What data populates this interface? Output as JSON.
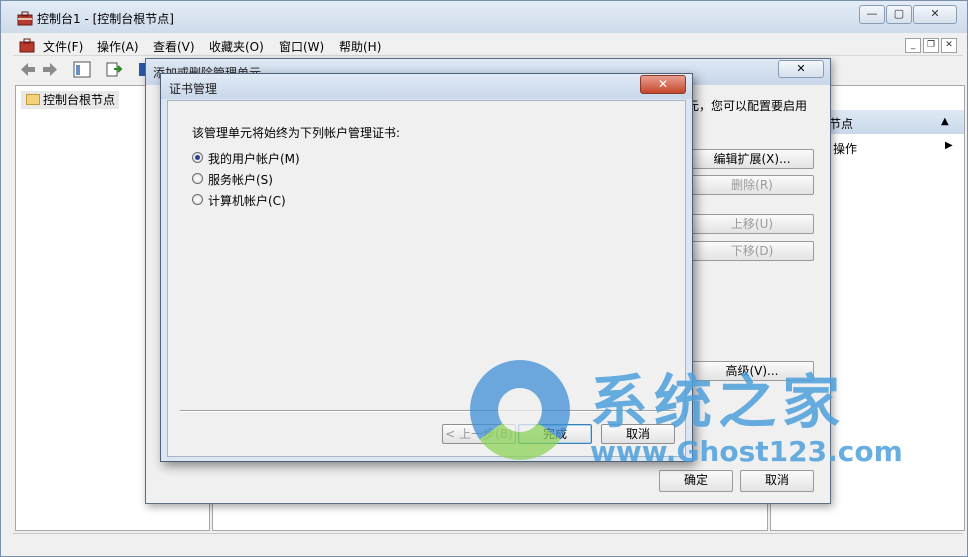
{
  "main_window": {
    "title": "控制台1 - [控制台根节点]",
    "caption_buttons": {
      "minimize": "—",
      "maximize": "▢",
      "close": "✕"
    }
  },
  "menubar": {
    "items": [
      "文件(F)",
      "操作(A)",
      "查看(V)",
      "收藏夹(O)",
      "窗口(W)",
      "帮助(H)"
    ],
    "mdi": {
      "minimize": "_",
      "restore": "❐",
      "close": "✕"
    }
  },
  "tree": {
    "root": "控制台根节点"
  },
  "actions_pane": {
    "header": "节点",
    "more": "操作",
    "collapse_glyph": "▲",
    "more_glyph": "▶"
  },
  "addremove_dialog": {
    "title": "添加或删除管理单元",
    "close": "✕",
    "description": "元，您可以配置要启用",
    "buttons": {
      "edit_extensions": "编辑扩展(X)...",
      "remove": "删除(R)",
      "move_up": "上移(U)",
      "move_down": "下移(D)",
      "advanced": "高级(V)...",
      "ok": "确定",
      "cancel": "取消"
    }
  },
  "cert_dialog": {
    "title": "证书管理",
    "close": "✕",
    "prompt": "该管理单元将始终为下列帐户管理证书:",
    "options": [
      {
        "label": "我的用户帐户(M)",
        "selected": true
      },
      {
        "label": "服务帐户(S)",
        "selected": false
      },
      {
        "label": "计算机帐户(C)",
        "selected": false
      }
    ],
    "buttons": {
      "back": "< 上一步(B)",
      "finish": "完成",
      "cancel": "取消"
    }
  },
  "watermark": {
    "title": "系统之家",
    "url": "www.Ghost123.com"
  }
}
